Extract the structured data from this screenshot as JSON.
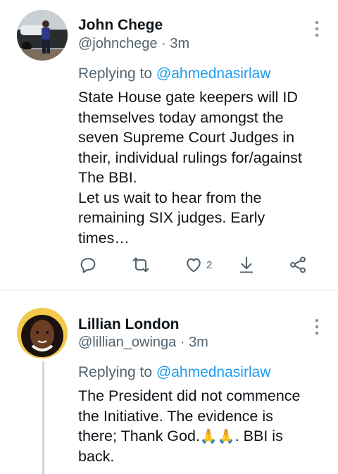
{
  "tweets": [
    {
      "author_name": "John Chege",
      "handle": "@johnchege",
      "time": "3m",
      "replying_to_prefix": "Replying to ",
      "replying_to": "@ahmednasirlaw",
      "text": "State House gate keepers will ID\nthemselves today amongst the\nseven Supreme Court Judges in\ntheir, individual rulings for/against\nThe BBI.\nLet us wait to hear from the\nremaining SIX judges. Early\ntimes…",
      "like_count": "2"
    },
    {
      "author_name": "Lillian London",
      "handle": "@lillian_owinga",
      "time": "3m",
      "replying_to_prefix": "Replying to ",
      "replying_to": "@ahmednasirlaw",
      "text_before_emoji": "The President did not commence\nthe Initiative. The evidence is\nthere; Thank God.",
      "emoji": "🙏🙏",
      "text_after_emoji": ". BBI is\nback."
    }
  ],
  "meta_separator": " · ",
  "icons": [
    "reply-icon",
    "retweet-icon",
    "like-icon",
    "download-icon",
    "share-icon",
    "more-options-icon"
  ],
  "colors": {
    "link": "#1d9bf0",
    "secondary": "#536471",
    "divider": "#eff3f4",
    "thread": "#cfd9de"
  }
}
